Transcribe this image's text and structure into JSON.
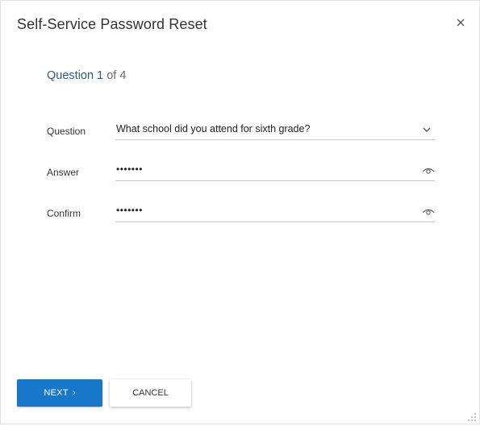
{
  "dialog": {
    "title": "Self-Service Password Reset"
  },
  "progress": {
    "word": "Question",
    "current": "1",
    "of": "of",
    "total": "4"
  },
  "form": {
    "question": {
      "label": "Question",
      "value": "What school did you attend for sixth grade?"
    },
    "answer": {
      "label": "Answer",
      "masked_value": "•••••••"
    },
    "confirm": {
      "label": "Confirm",
      "masked_value": "•••••••"
    }
  },
  "buttons": {
    "next_label": "NEXT",
    "next_arrow": "›",
    "cancel_label": "CANCEL"
  },
  "colors": {
    "primary": "#1877c9",
    "link_blue": "#2f5a8c",
    "text": "#333333",
    "underline": "#c8c8c8"
  },
  "icons": {
    "close": "close-icon",
    "dropdown": "chevron-down-icon",
    "reveal": "eye-icon",
    "resize": "resize-grip-icon"
  }
}
